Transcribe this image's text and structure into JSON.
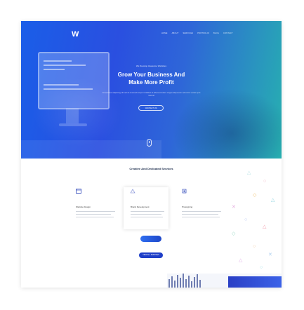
{
  "header": {
    "logo_text": "W",
    "nav": [
      "Home",
      "About",
      "Services",
      "Portfolio",
      "Blog",
      "Contact"
    ]
  },
  "hero": {
    "eyebrow": "We Develop Awesome Websites",
    "title_line1": "Grow Your Business And",
    "title_line2": "Make More Profit",
    "description": "Consectetur adipiscing elit sed do eiusmod tempor incididunt ut labore et dolore magna aliqua enim ad minim veniam quis nostrud",
    "button_label": "Contact Us"
  },
  "services": {
    "title": "Creative And Dedicated Services",
    "cards": [
      {
        "name": "Website Design",
        "icon": "browser-icon",
        "active": false
      },
      {
        "name": "Brand Development",
        "icon": "pen-tool-icon",
        "active": true
      },
      {
        "name": "Prototyping",
        "icon": "layers-icon",
        "active": false
      }
    ],
    "button_label": "View All Services"
  },
  "colors": {
    "accent": "#1f48c9",
    "hero_start": "#1a5ee8",
    "hero_end": "#27b0b0",
    "heading": "#1a2a4a"
  }
}
